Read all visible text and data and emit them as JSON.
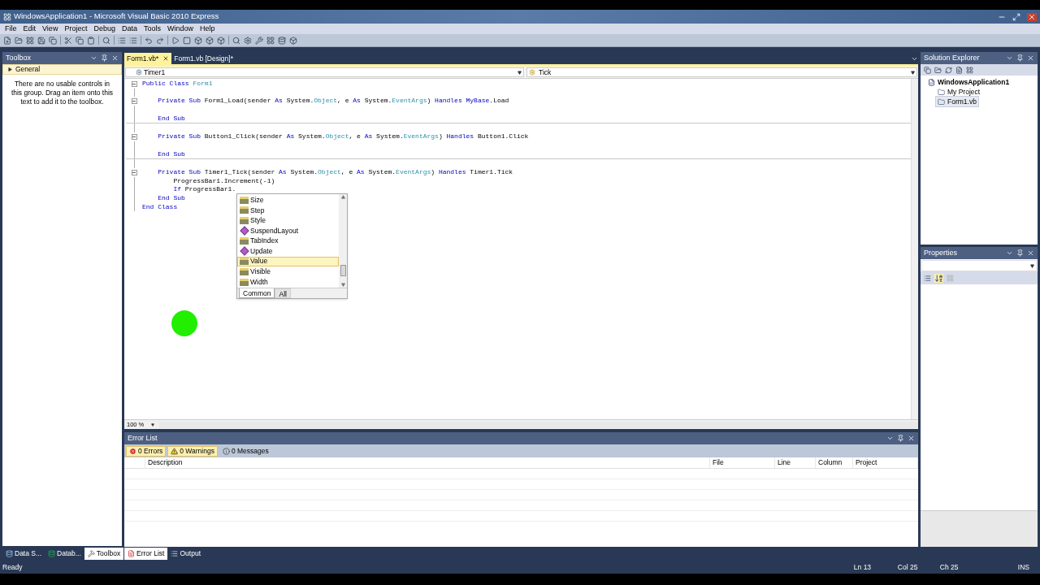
{
  "window": {
    "title": "WindowsApplication1 - Microsoft Visual Basic 2010 Express"
  },
  "menu": [
    "File",
    "Edit",
    "View",
    "Project",
    "Debug",
    "Data",
    "Tools",
    "Window",
    "Help"
  ],
  "toolbox": {
    "title": "Toolbox",
    "group": "General",
    "message": "There are no usable controls in this group. Drag an item onto this text to add it to the toolbox."
  },
  "editor_tabs": [
    {
      "label": "Form1.vb*",
      "selected": true
    },
    {
      "label": "Form1.vb [Design]*",
      "selected": false
    }
  ],
  "editor": {
    "class_dropdown": "Timer1",
    "method_dropdown": "Tick",
    "zoom": "100 %",
    "blocks": [
      {
        "lines": [
          {
            "fold": true,
            "segments": [
              {
                "kind": "kw",
                "text": "Public Class "
              },
              {
                "kind": "type",
                "text": "Form1"
              }
            ]
          },
          {
            "fold": false
          },
          {
            "fold": true,
            "segments": [
              {
                "kind": "kw",
                "text": "    Private Sub "
              },
              {
                "kind": "text",
                "text": "Form1_Load(sender "
              },
              {
                "kind": "kw",
                "text": "As "
              },
              {
                "kind": "text",
                "text": "System."
              },
              {
                "kind": "type",
                "text": "Object"
              },
              {
                "kind": "text",
                "text": ", e "
              },
              {
                "kind": "kw",
                "text": "As "
              },
              {
                "kind": "text",
                "text": "System."
              },
              {
                "kind": "type",
                "text": "EventArgs"
              },
              {
                "kind": "text",
                "text": ") "
              },
              {
                "kind": "kw",
                "text": "Handles MyBase"
              },
              {
                "kind": "text",
                "text": ".Load"
              }
            ]
          },
          {
            "fold": false
          },
          {
            "fold": false,
            "segments": [
              {
                "kind": "kw",
                "text": "    End Sub"
              }
            ]
          }
        ]
      },
      {
        "lines": [
          {
            "fold": false
          },
          {
            "fold": true,
            "segments": [
              {
                "kind": "kw",
                "text": "    Private Sub "
              },
              {
                "kind": "text",
                "text": "Button1_Click(sender "
              },
              {
                "kind": "kw",
                "text": "As "
              },
              {
                "kind": "text",
                "text": "System."
              },
              {
                "kind": "type",
                "text": "Object"
              },
              {
                "kind": "text",
                "text": ", e "
              },
              {
                "kind": "kw",
                "text": "As "
              },
              {
                "kind": "text",
                "text": "System."
              },
              {
                "kind": "type",
                "text": "EventArgs"
              },
              {
                "kind": "text",
                "text": ") "
              },
              {
                "kind": "kw",
                "text": "Handles "
              },
              {
                "kind": "text",
                "text": "Button1.Click"
              }
            ]
          },
          {
            "fold": false
          },
          {
            "fold": false,
            "segments": [
              {
                "kind": "kw",
                "text": "    End Sub"
              }
            ]
          }
        ]
      },
      {
        "lines": [
          {
            "fold": false
          },
          {
            "fold": true,
            "segments": [
              {
                "kind": "kw",
                "text": "    Private Sub "
              },
              {
                "kind": "text",
                "text": "Timer1_Tick(sender "
              },
              {
                "kind": "kw",
                "text": "As "
              },
              {
                "kind": "text",
                "text": "System."
              },
              {
                "kind": "type",
                "text": "Object"
              },
              {
                "kind": "text",
                "text": ", e "
              },
              {
                "kind": "kw",
                "text": "As "
              },
              {
                "kind": "text",
                "text": "System."
              },
              {
                "kind": "type",
                "text": "EventArgs"
              },
              {
                "kind": "text",
                "text": ") "
              },
              {
                "kind": "kw",
                "text": "Handles "
              },
              {
                "kind": "text",
                "text": "Timer1.Tick"
              }
            ]
          },
          {
            "fold": false,
            "segments": [
              {
                "kind": "text",
                "text": "        ProgressBar1.Increment(-1)"
              }
            ]
          },
          {
            "fold": false,
            "segments": [
              {
                "kind": "kw",
                "text": "        If "
              },
              {
                "kind": "text",
                "text": "ProgressBar1."
              }
            ]
          },
          {
            "fold": false,
            "segments": [
              {
                "kind": "kw",
                "text": "    End Sub"
              }
            ]
          },
          {
            "fold": false,
            "segments": [
              {
                "kind": "kw",
                "text": "End Class"
              }
            ]
          }
        ]
      }
    ],
    "completion": {
      "items": [
        {
          "kind": "property",
          "label": "Size",
          "selected": false
        },
        {
          "kind": "property",
          "label": "Step",
          "selected": false
        },
        {
          "kind": "property",
          "label": "Style",
          "selected": false
        },
        {
          "kind": "method",
          "label": "SuspendLayout",
          "selected": false
        },
        {
          "kind": "property",
          "label": "TabIndex",
          "selected": false
        },
        {
          "kind": "method",
          "label": "Update",
          "selected": false
        },
        {
          "kind": "property",
          "label": "Value",
          "selected": true
        },
        {
          "kind": "property",
          "label": "Visible",
          "selected": false
        },
        {
          "kind": "property",
          "label": "Width",
          "selected": false
        }
      ],
      "tabs": [
        {
          "label": "Common",
          "selected": true
        },
        {
          "label": "All",
          "selected": false
        }
      ]
    }
  },
  "error_list": {
    "title": "Error List",
    "filters": [
      {
        "kind": "error",
        "label": "0 Errors",
        "selected": true
      },
      {
        "kind": "warning",
        "label": "0 Warnings",
        "selected": true
      },
      {
        "kind": "info",
        "label": "0 Messages",
        "selected": false
      }
    ],
    "columns": [
      "Description",
      "File",
      "Line",
      "Column",
      "Project"
    ]
  },
  "left_tabs": [
    {
      "kind": "data",
      "label": "Data S...",
      "selected": false
    },
    {
      "kind": "database",
      "label": "Datab...",
      "selected": false
    },
    {
      "kind": "toolbox",
      "label": "Toolbox",
      "selected": true
    }
  ],
  "bottom_tabs": [
    {
      "kind": "errors",
      "label": "Error List",
      "selected": true
    },
    {
      "kind": "output",
      "label": "Output",
      "selected": false
    }
  ],
  "solution_explorer": {
    "title": "Solution Explorer",
    "tree": [
      {
        "label": "WindowsApplication1",
        "selected": false,
        "children": [
          {
            "label": "My Project",
            "selected": false
          },
          {
            "label": "Form1.vb",
            "selected": true
          }
        ]
      }
    ]
  },
  "properties": {
    "title": "Properties"
  },
  "status_bar": {
    "message": "Ready",
    "line": "Ln 13",
    "column": "Col 25",
    "char": "Ch 25",
    "mode": "INS"
  }
}
